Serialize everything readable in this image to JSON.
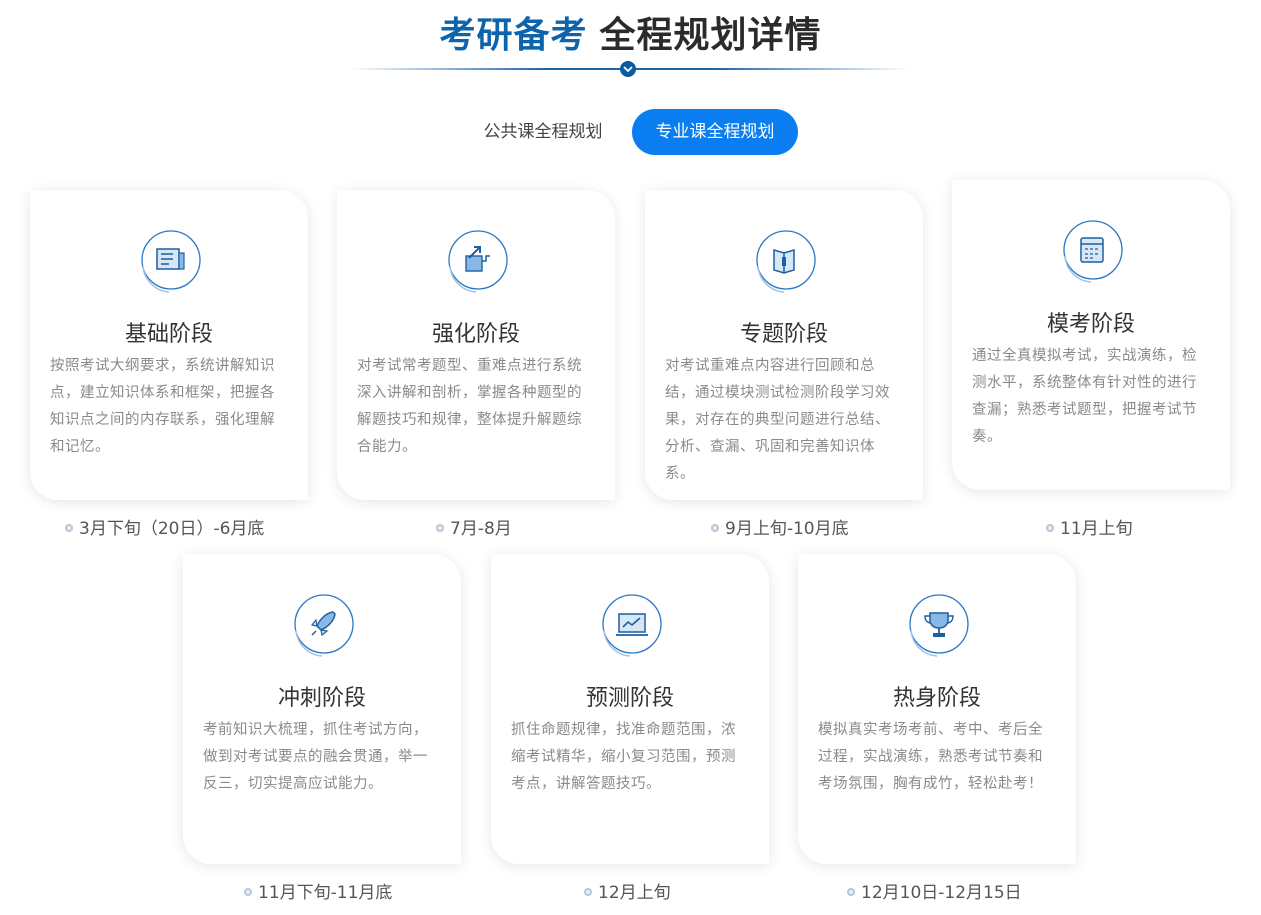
{
  "header": {
    "title_highlight": "考研备考",
    "title_main": "全程规划详情"
  },
  "tabs": [
    {
      "label": "公共课全程规划",
      "active": false
    },
    {
      "label": "专业课全程规划",
      "active": true
    }
  ],
  "accent_color": "#0a7ef0",
  "stages": [
    {
      "icon": "newspaper-icon",
      "name": "基础阶段",
      "desc": "按照考试大纲要求，系统讲解知识点，建立知识体系和框架，把握各知识点之间的内存联系，强化理解和记忆。",
      "date": "3月下旬（20日）-6月底"
    },
    {
      "icon": "trend-arrow-icon",
      "name": "强化阶段",
      "desc": "对考试常考题型、重难点进行系统深入讲解和剖析，掌握各种题型的解题技巧和规律，整体提升解题综合能力。",
      "date": "7月-8月"
    },
    {
      "icon": "open-book-icon",
      "name": "专题阶段",
      "desc": "对考试重难点内容进行回顾和总结，通过模块测试检测阶段学习效果，对存在的典型问题进行总结、分析、查漏、巩固和完善知识体系。",
      "date": "9月上旬-10月底"
    },
    {
      "icon": "exam-sheet-icon",
      "name": "模考阶段",
      "desc": "通过全真模拟考试，实战演练，检测水平，系统整体有针对性的进行查漏；熟悉考试题型，把握考试节奏。",
      "date": "11月上旬"
    },
    {
      "icon": "rocket-icon",
      "name": "冲刺阶段",
      "desc": "考前知识大梳理，抓住考试方向，做到对考试要点的融会贯通，举一反三，切实提高应试能力。",
      "date": "11月下旬-11月底"
    },
    {
      "icon": "chart-screen-icon",
      "name": "预测阶段",
      "desc": "抓住命题规律，找准命题范围，浓缩考试精华，缩小复习范围，预测考点，讲解答题技巧。",
      "date": "12月上旬"
    },
    {
      "icon": "trophy-icon",
      "name": "热身阶段",
      "desc": "模拟真实考场考前、考中、考后全过程，实战演练，熟悉考试节奏和考场氛围，胸有成竹，轻松赴考！",
      "date": "12月10日-12月15日"
    }
  ]
}
